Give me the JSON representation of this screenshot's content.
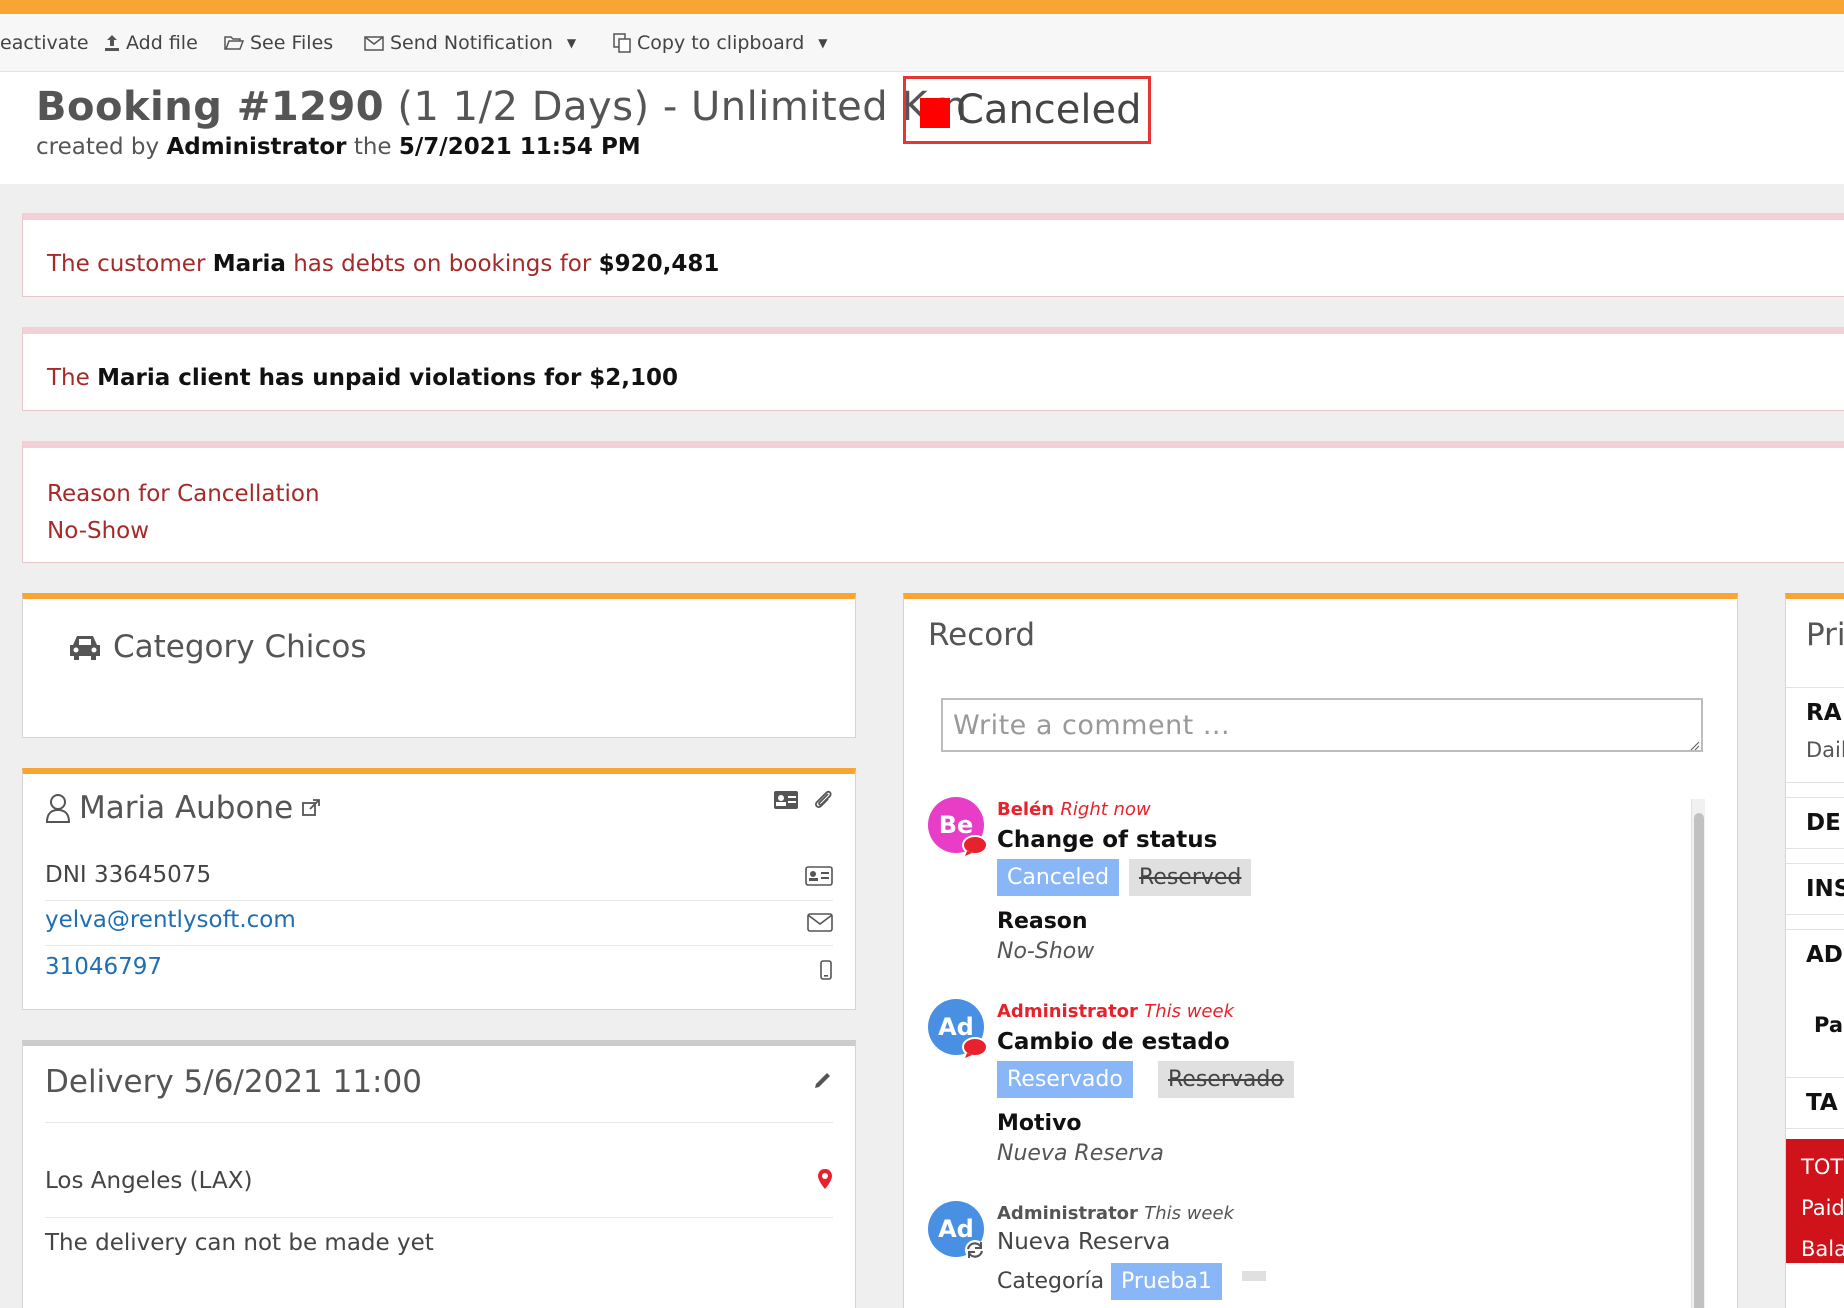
{
  "toolbar": {
    "reactivate": "eactivate",
    "add_file": "Add file",
    "see_files": "See Files",
    "send_notification": "Send Notification",
    "copy_clipboard": "Copy to clipboard"
  },
  "header": {
    "booking": "Booking #1290",
    "duration": "(1 1/2 Days) - Unlimited Km",
    "created_by_prefix": "created by",
    "created_by": "Administrator",
    "created_the": "the",
    "created_at": "5/7/2021 11:54 PM",
    "status": "Canceled",
    "status_color": "#ff0000"
  },
  "alerts": {
    "debt_prefix": "The customer",
    "debt_name": "Maria",
    "debt_middle": "has debts on bookings for",
    "debt_amount": "$920,481",
    "viol_prefix": "The",
    "viol_text": "Maria client has unpaid violations for $2,100",
    "cancel_label": "Reason for Cancellation",
    "cancel_reason": "No-Show"
  },
  "category": {
    "title": "Category Chicos"
  },
  "customer": {
    "name": "Maria Aubone",
    "dni": "DNI 33645075",
    "email": "yelva@rentlysoft.com",
    "phone": "31046797"
  },
  "delivery": {
    "title": "Delivery 5/6/2021 11:00",
    "location": "Los Angeles (LAX)",
    "note": "The delivery can not be made yet"
  },
  "record": {
    "title": "Record",
    "comment_placeholder": "Write a comment ...",
    "entries": [
      {
        "initials": "Be",
        "author": "Belén",
        "when": "Right now",
        "title": "Change of status",
        "new_tag": "Canceled",
        "old_tag": "Reserved",
        "label": "Reason",
        "value": "No-Show"
      },
      {
        "initials": "Ad",
        "author": "Administrator",
        "when": "This week",
        "title": "Cambio de estado",
        "new_tag": "Reservado",
        "old_tag": "Reservado",
        "label": "Motivo",
        "value": "Nueva Reserva"
      },
      {
        "initials": "Ad",
        "author": "Administrator",
        "when": "This week",
        "title": "Nueva Reserva",
        "label": "Categoría",
        "new_tag": "Prueba1"
      }
    ]
  },
  "prices": {
    "title": "Pri",
    "rows": [
      "RA",
      "Dail",
      "DE",
      "INS",
      "AD",
      "Pa",
      "TA"
    ],
    "total": "TOT",
    "paid": "Paid",
    "balance": "Bala"
  },
  "colors": {
    "accent": "#f9a534",
    "alert_text": "#a52a2a",
    "tag_blue": "#89b6f7",
    "total_red": "#d0121b"
  }
}
